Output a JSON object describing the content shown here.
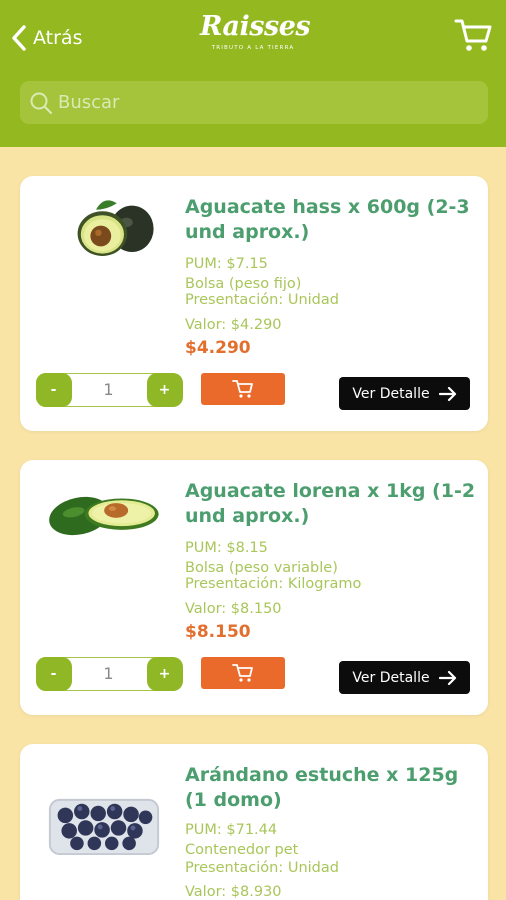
{
  "header": {
    "back_label": "Atrás",
    "logo_text": "Raisses",
    "logo_tagline": "TRIBUTO A LA TIERRA",
    "search_placeholder": "Buscar"
  },
  "colors": {
    "brand_green": "#93b820",
    "background": "#f9e4a6",
    "title_green": "#4c9e6f",
    "price_orange": "#e26f2e",
    "cart_button_orange": "#e96a2a",
    "detail_button_black": "#0c0c0c"
  },
  "icons": {
    "back": "chevron-left-icon",
    "cart": "shopping-cart-icon",
    "search": "magnifier-icon",
    "arrow": "arrow-right-icon"
  },
  "products": [
    {
      "title": "Aguacate hass x 600g (2-3 und aprox.)",
      "pum": "PUM: $7.15",
      "packaging": "Bolsa (peso fijo)",
      "presentation": "Presentación: Unidad",
      "valor": "Valor: $4.290",
      "price": "$4.290",
      "quantity": "1",
      "minus_label": "-",
      "plus_label": "+",
      "detail_label": "Ver Detalle"
    },
    {
      "title": "Aguacate lorena x 1kg (1-2 und aprox.)",
      "pum": "PUM: $8.15",
      "packaging": "Bolsa (peso variable)",
      "presentation": "Presentación: Kilogramo",
      "valor": "Valor: $8.150",
      "price": "$8.150",
      "quantity": "1",
      "minus_label": "-",
      "plus_label": "+",
      "detail_label": "Ver Detalle"
    },
    {
      "title": "Arándano estuche x 125g (1 domo)",
      "pum": "PUM: $71.44",
      "packaging": "Contenedor pet",
      "presentation": "Presentación: Unidad",
      "valor": "Valor: $8.930"
    }
  ]
}
